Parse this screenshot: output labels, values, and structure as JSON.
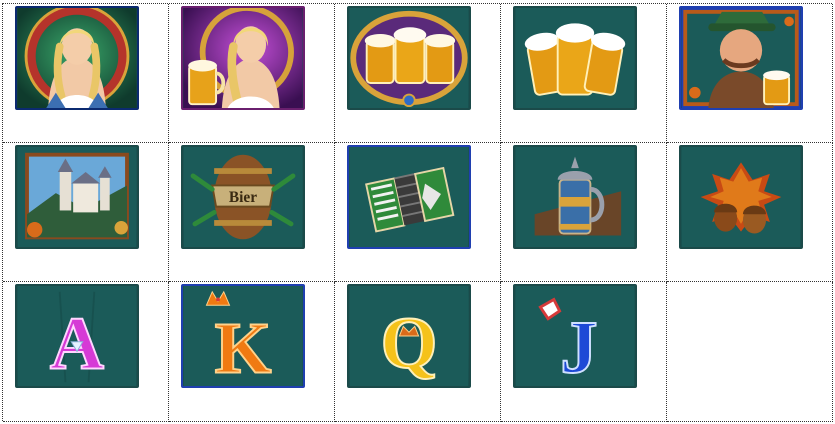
{
  "symbols": [
    {
      "name": "blonde-woman-wild",
      "row": 1,
      "col": 1
    },
    {
      "name": "blonde-woman-with-beer",
      "row": 1,
      "col": 2
    },
    {
      "name": "beer-mugs-gold-frame",
      "row": 1,
      "col": 3
    },
    {
      "name": "beer-mugs-splash",
      "row": 1,
      "col": 4
    },
    {
      "name": "bavarian-man-with-beer",
      "row": 1,
      "col": 5
    },
    {
      "name": "castle",
      "row": 2,
      "col": 1
    },
    {
      "name": "bier-barrel",
      "row": 2,
      "col": 2,
      "text": "Bier"
    },
    {
      "name": "accordion",
      "row": 2,
      "col": 3
    },
    {
      "name": "beer-stein",
      "row": 2,
      "col": 4
    },
    {
      "name": "autumn-leaves-acorns",
      "row": 2,
      "col": 5
    },
    {
      "name": "letter-a",
      "row": 3,
      "col": 1,
      "text": "A"
    },
    {
      "name": "letter-k",
      "row": 3,
      "col": 2,
      "text": "K"
    },
    {
      "name": "letter-q",
      "row": 3,
      "col": 3,
      "text": "Q"
    },
    {
      "name": "letter-j",
      "row": 3,
      "col": 4,
      "text": "J"
    }
  ],
  "colors": {
    "tile_bg": "#1b5b59",
    "tile_border": "#1f3a8a",
    "letter_a": "#d63ad6",
    "letter_k": "#f07a12",
    "letter_q": "#f5c21a",
    "letter_j": "#1d49d6"
  }
}
